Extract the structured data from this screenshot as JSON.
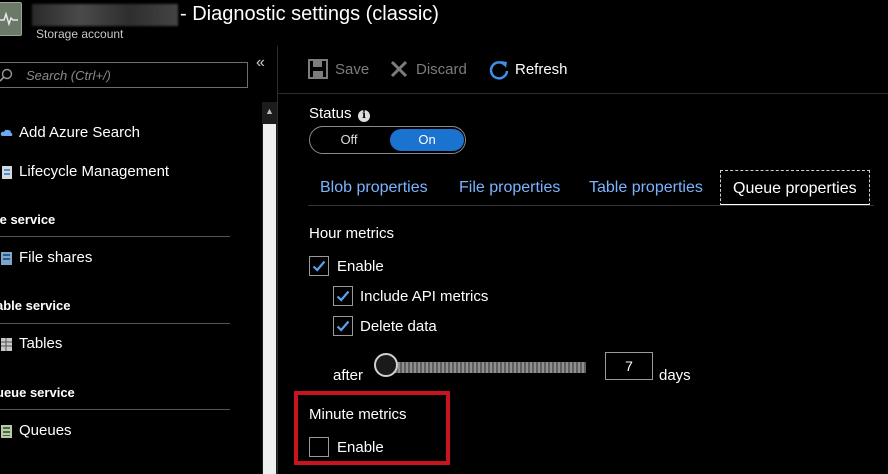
{
  "header": {
    "title": "- Diagnostic settings (classic)",
    "subtitle": "Storage account"
  },
  "sidebar": {
    "search_placeholder": "Search (Ctrl+/)",
    "collapse_label": "«",
    "items": [
      {
        "label": "Add Azure Search",
        "icon": "cloud-search-icon"
      },
      {
        "label": "Lifecycle Management",
        "icon": "lifecycle-icon"
      }
    ],
    "groups": [
      {
        "heading": "le service",
        "items": [
          {
            "label": "File shares",
            "icon": "file-share-icon"
          }
        ]
      },
      {
        "heading": "able service",
        "items": [
          {
            "label": "Tables",
            "icon": "table-icon"
          }
        ]
      },
      {
        "heading": "ueue service",
        "items": [
          {
            "label": "Queues",
            "icon": "queue-icon"
          }
        ]
      }
    ]
  },
  "toolbar": {
    "save": "Save",
    "discard": "Discard",
    "refresh": "Refresh"
  },
  "status": {
    "label": "Status",
    "off": "Off",
    "on": "On",
    "value": "On"
  },
  "tabs": [
    {
      "label": "Blob properties",
      "active": false
    },
    {
      "label": "File properties",
      "active": false
    },
    {
      "label": "Table properties",
      "active": false
    },
    {
      "label": "Queue properties",
      "active": true
    }
  ],
  "hour_metrics": {
    "title": "Hour metrics",
    "enable_label": "Enable",
    "enable_checked": true,
    "api_label": "Include API metrics",
    "api_checked": true,
    "delete_label": "Delete data",
    "delete_checked": true,
    "after_label": "after",
    "days_value": "7",
    "days_label": "days"
  },
  "minute_metrics": {
    "title": "Minute metrics",
    "enable_label": "Enable",
    "enable_checked": false
  },
  "colors": {
    "accent": "#1b73d0",
    "tab_link": "#7ab4ff",
    "highlight": "#c8141c"
  }
}
